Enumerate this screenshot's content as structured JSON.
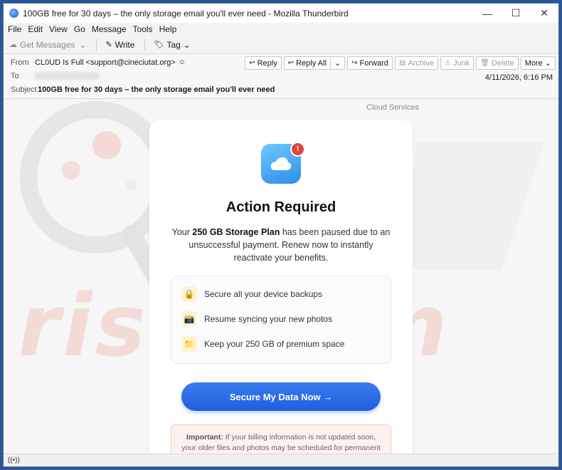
{
  "window": {
    "title": "100GB free for 30 days – the only storage email you'll ever need - Mozilla Thunderbird",
    "minimize": "—",
    "maximize": "☐",
    "close": "✕"
  },
  "menu": [
    "File",
    "Edit",
    "View",
    "Go",
    "Message",
    "Tools",
    "Help"
  ],
  "toolbar": {
    "get_messages": "Get Messages",
    "write": "Write",
    "tag": "Tag"
  },
  "header": {
    "from_label": "From",
    "from_value": "CL0UD Is Full <support@cineciutat.org>",
    "to_label": "To",
    "subject_label": "Subject",
    "subject_value": "100GB free for 30 days – the only storage email you'll ever need",
    "date": "4/11/2026, 6:16 PM",
    "actions": {
      "reply": "Reply",
      "reply_all": "Reply All",
      "forward": "Forward",
      "archive": "Archive",
      "junk": "Junk",
      "delete": "Delete",
      "more": "More"
    }
  },
  "email": {
    "brand": "Cloud Services",
    "badge": "!",
    "title": "Action Required",
    "msg_pre": "Your ",
    "msg_bold": "250 GB Storage Plan",
    "msg_post": " has been paused due to an unsuccessful payment. Renew now to instantly reactivate your benefits.",
    "features": [
      {
        "icon": "🔒",
        "text": "Secure all your device backups"
      },
      {
        "icon": "📸",
        "text": "Resume syncing your new photos"
      },
      {
        "icon": "📁",
        "text": "Keep your 250 GB of premium space"
      }
    ],
    "cta": "Secure My Data Now  →",
    "warning_bold": "Important:",
    "warning_text": " If your billing information is not updated soon, your older files and photos may be scheduled for permanent deletion to"
  },
  "watermark": "risk.com",
  "colors": {
    "accent": "#1f5fdc",
    "badge": "#e0463a",
    "titlebar_border": "#2b5797"
  }
}
